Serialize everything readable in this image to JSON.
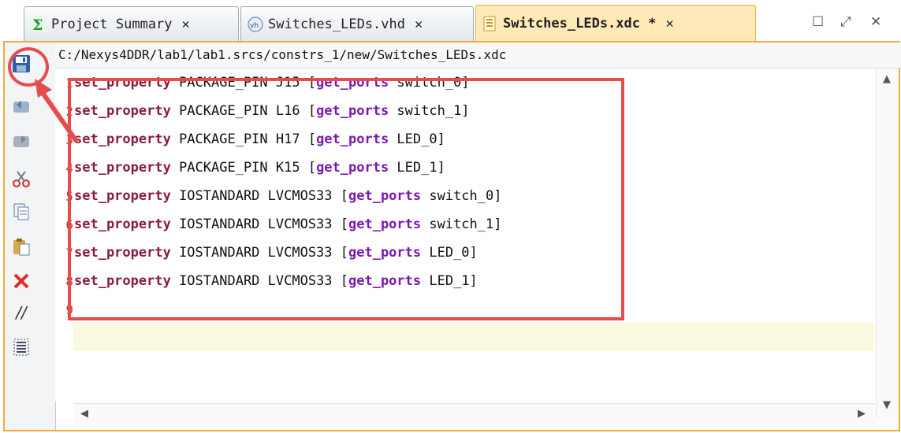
{
  "tabs": [
    {
      "label": "Project Summary",
      "icon": "sigma-icon",
      "close": "✕",
      "active": false
    },
    {
      "label": "Switches_LEDs.vhd",
      "icon": "vhdl-file-icon",
      "close": "✕",
      "active": false
    },
    {
      "label": "Switches_LEDs.xdc *",
      "icon": "constraints-file-icon",
      "close": "✕",
      "active": true
    }
  ],
  "window_controls": {
    "restore": "☐",
    "float": "⤢",
    "close": "✕"
  },
  "editor": {
    "path": "C:/Nexys4DDR/lab1/lab1.srcs/constrs_1/new/Switches_LEDs.xdc",
    "lines": [
      {
        "num": "1",
        "kw": "set_property",
        "mid": " PACKAGE_PIN J15 [",
        "fn": "get_ports",
        "tail": " switch_0]"
      },
      {
        "num": "2",
        "kw": "set_property",
        "mid": " PACKAGE_PIN L16 [",
        "fn": "get_ports",
        "tail": " switch_1]"
      },
      {
        "num": "3",
        "kw": "set_property",
        "mid": " PACKAGE_PIN H17 [",
        "fn": "get_ports",
        "tail": " LED_0]"
      },
      {
        "num": "4",
        "kw": "set_property",
        "mid": " PACKAGE_PIN K15 [",
        "fn": "get_ports",
        "tail": " LED_1]"
      },
      {
        "num": "5",
        "kw": "set_property",
        "mid": " IOSTANDARD LVCMOS33 [",
        "fn": "get_ports",
        "tail": " switch_0]"
      },
      {
        "num": "6",
        "kw": "set_property",
        "mid": " IOSTANDARD LVCMOS33 [",
        "fn": "get_ports",
        "tail": " switch_1]"
      },
      {
        "num": "7",
        "kw": "set_property",
        "mid": " IOSTANDARD LVCMOS33 [",
        "fn": "get_ports",
        "tail": " LED_0]"
      },
      {
        "num": "8",
        "kw": "set_property",
        "mid": " IOSTANDARD LVCMOS33 [",
        "fn": "get_ports",
        "tail": " LED_1]"
      },
      {
        "num": "9",
        "kw": "",
        "mid": "",
        "fn": "",
        "tail": ""
      }
    ]
  },
  "toolbar": [
    {
      "name": "save-icon"
    },
    {
      "name": "undo-icon"
    },
    {
      "name": "redo-icon"
    },
    {
      "name": "cut-icon"
    },
    {
      "name": "copy-icon"
    },
    {
      "name": "paste-icon"
    },
    {
      "name": "delete-icon"
    },
    {
      "name": "comment-icon",
      "glyph": "//"
    },
    {
      "name": "block-select-icon"
    }
  ],
  "colors": {
    "accent": "#f2ad3d",
    "keyword": "#8b1b3a",
    "function": "#7a17b4",
    "annotation": "#e54d4d",
    "line_number": "#c0392b"
  }
}
